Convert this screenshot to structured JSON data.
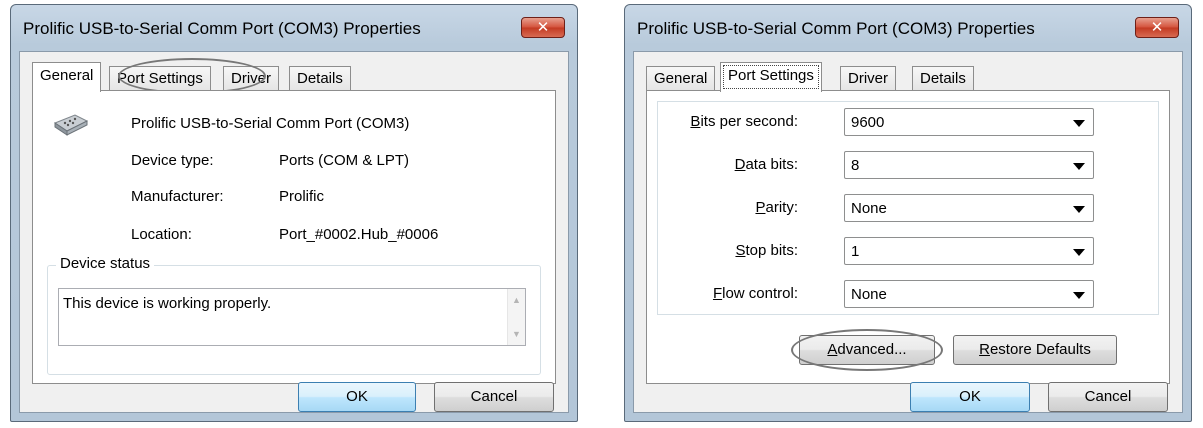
{
  "left_dialog": {
    "title": "Prolific USB-to-Serial Comm Port (COM3) Properties",
    "tabs": [
      "General",
      "Port Settings",
      "Driver",
      "Details"
    ],
    "active_tab": "General",
    "device_name": "Prolific USB-to-Serial Comm Port (COM3)",
    "rows": [
      {
        "label": "Device type:",
        "value": "Ports (COM & LPT)"
      },
      {
        "label": "Manufacturer:",
        "value": "Prolific"
      },
      {
        "label": "Location:",
        "value": "Port_#0002.Hub_#0006"
      }
    ],
    "status_group_title": "Device status",
    "status_text": "This device is working properly.",
    "ok_label": "OK",
    "cancel_label": "Cancel"
  },
  "right_dialog": {
    "title": "Prolific USB-to-Serial Comm Port (COM3) Properties",
    "tabs": [
      "General",
      "Port Settings",
      "Driver",
      "Details"
    ],
    "active_tab": "Port Settings",
    "fields": [
      {
        "label_accel": "B",
        "label_rest": "its per second:",
        "value": "9600"
      },
      {
        "label_accel": "D",
        "label_rest": "ata bits:",
        "value": "8"
      },
      {
        "label_accel": "P",
        "label_rest": "arity:",
        "value": "None"
      },
      {
        "label_accel": "S",
        "label_rest": "top bits:",
        "value": "1"
      },
      {
        "label_accel": "F",
        "label_rest": "low control:",
        "value": "None"
      }
    ],
    "advanced_accel": "A",
    "advanced_rest": "dvanced...",
    "restore_accel": "R",
    "restore_rest": "estore Defaults",
    "ok_label": "OK",
    "cancel_label": "Cancel"
  },
  "icons": {
    "close": "close-icon",
    "device": "serial-port-icon",
    "combo_arrow": "chevron-down-icon"
  },
  "close_glyph": "✕",
  "colors": {
    "title_bar": "#b8cadb",
    "close_button": "#c33a22",
    "default_button": "#bee6fd"
  }
}
